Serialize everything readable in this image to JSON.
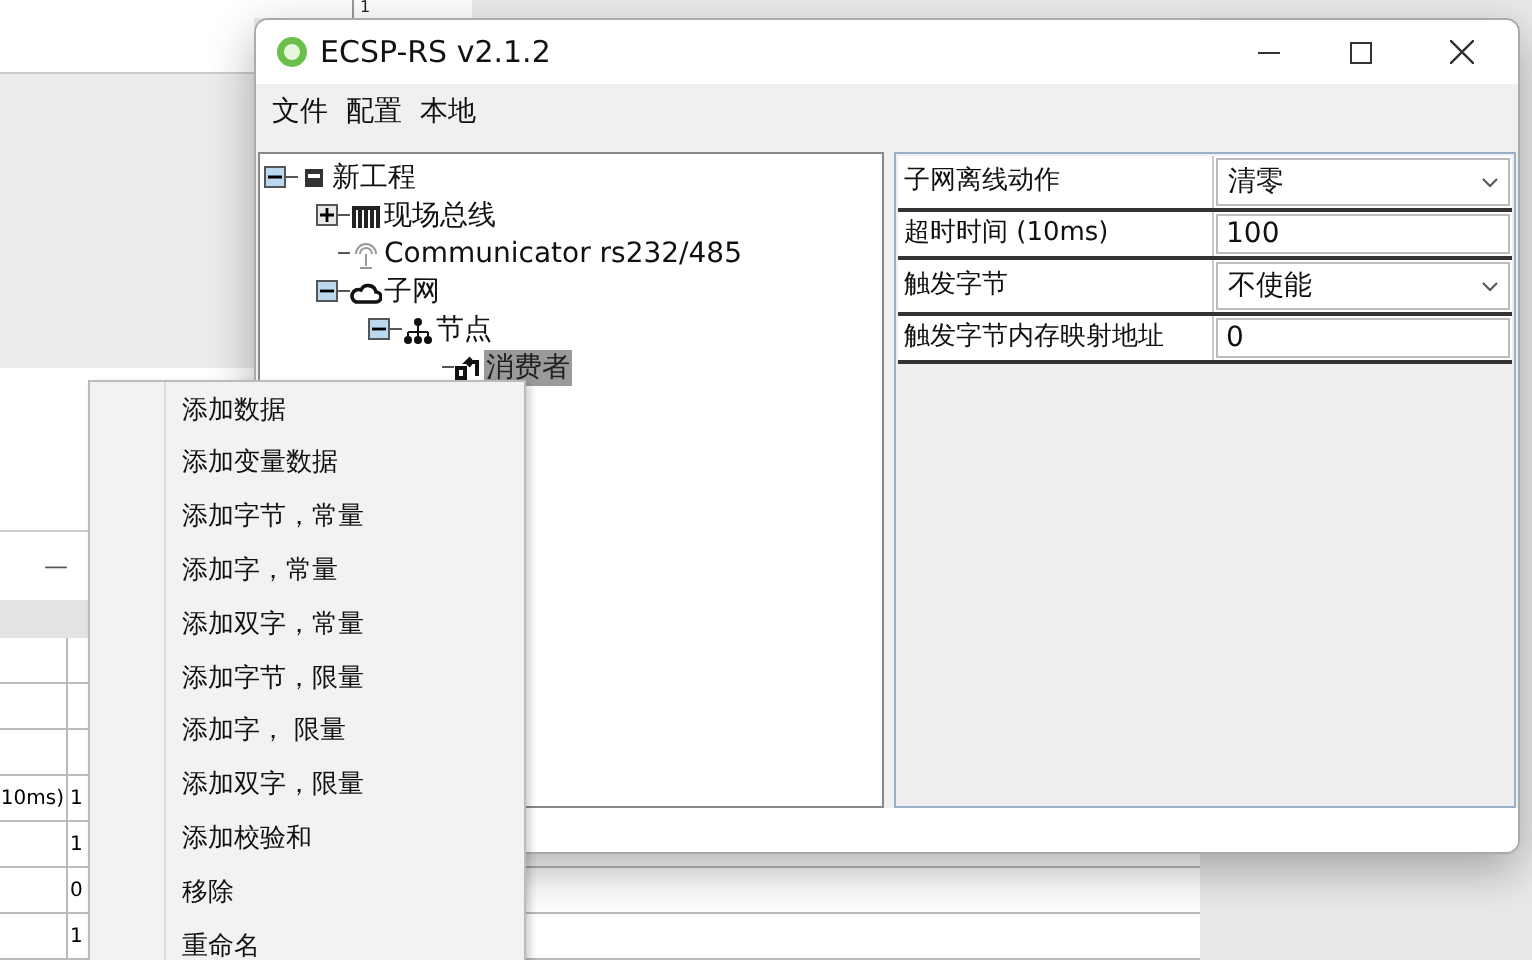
{
  "background_window": {
    "top_field_value": "1",
    "minimize_symbol": "—",
    "table_rows": [
      {},
      {},
      {},
      {
        "column_1": "10ms)",
        "column_2": "1"
      },
      {
        "column_2": "1"
      },
      {
        "column_2": "0"
      },
      {
        "column_2": "1"
      }
    ]
  },
  "window": {
    "title": "ECSP-RS v2.1.2"
  },
  "menu_bar": [
    "文件",
    "配置",
    "本地"
  ],
  "tree": [
    {
      "label": "新工程",
      "kind": "project",
      "expanded": true,
      "selected": false,
      "children": [
        {
          "label": "现场总线",
          "kind": "bus",
          "expanded": false,
          "selected": false
        },
        {
          "label": "Communicator rs232/485",
          "kind": "antenna",
          "selected": false
        },
        {
          "label": "子网",
          "kind": "cloud",
          "expanded": true,
          "selected": false,
          "children": [
            {
              "label": "节点",
              "kind": "network",
              "expanded": true,
              "selected": false,
              "children": [
                {
                  "label": "消费者",
                  "kind": "consumer",
                  "selected": true
                }
              ]
            }
          ]
        }
      ]
    }
  ],
  "properties": [
    {
      "label": "子网离线动作",
      "value": "清零",
      "kind": "dropdown"
    },
    {
      "label": "超时时间 (10ms)",
      "value": "100",
      "kind": "text"
    },
    {
      "label": "触发字节",
      "value": "不使能",
      "kind": "dropdown"
    },
    {
      "label": "触发字节内存映射地址",
      "value": "0",
      "kind": "text"
    }
  ],
  "context_menu": [
    "添加数据",
    "添加变量数据",
    "添加字节，常量",
    "添加字，常量",
    "添加双字，常量",
    "添加字节，限量",
    "添加字， 限量",
    "添加双字，限量",
    "添加校验和",
    "移除",
    "重命名"
  ]
}
